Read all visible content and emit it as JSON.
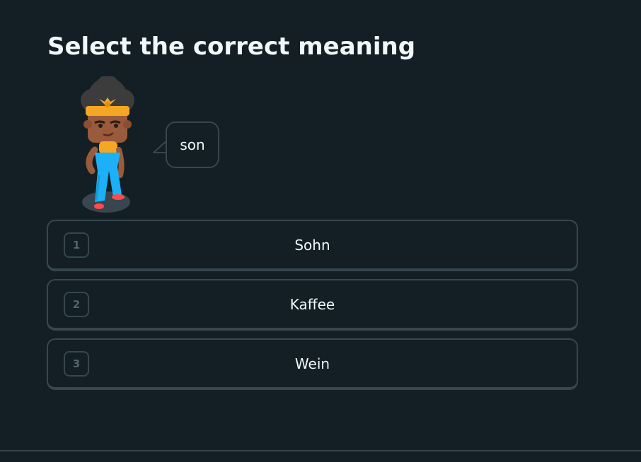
{
  "prompt": {
    "title": "Select the correct meaning"
  },
  "speech_bubble": {
    "text": "son"
  },
  "options": [
    {
      "key": "1",
      "label": "Sohn"
    },
    {
      "key": "2",
      "label": "Kaffee"
    },
    {
      "key": "3",
      "label": "Wein"
    }
  ],
  "colors": {
    "background": "#131f24",
    "border": "#37464f",
    "text": "#f1f7fb",
    "key_text": "#52656d"
  }
}
